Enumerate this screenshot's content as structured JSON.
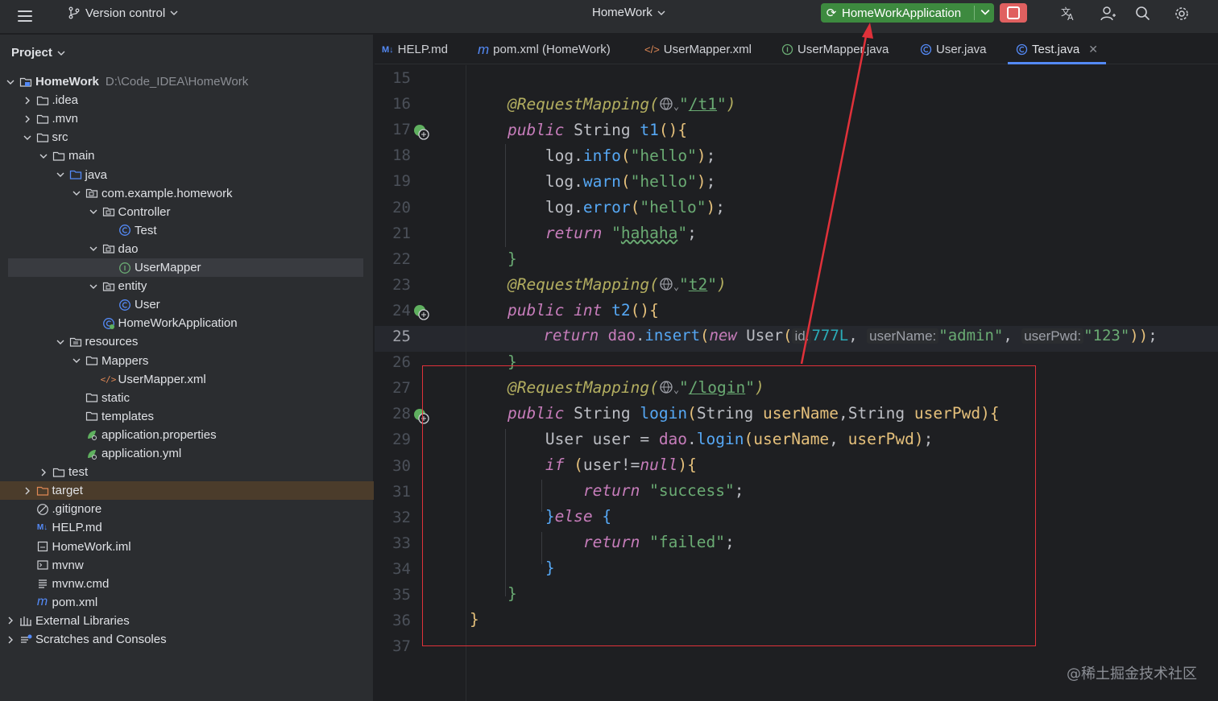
{
  "topbar": {
    "vcs_label": "Version control",
    "project_title": "HomeWork",
    "run_config": "HomeWorkApplication",
    "accent_green": "#3d8a3f",
    "stop_color": "#e06060"
  },
  "project_panel": {
    "header": "Project",
    "root_name": "HomeWork",
    "root_path": "D:\\Code_IDEA\\HomeWork",
    "items": [
      {
        "label": ".idea"
      },
      {
        "label": ".mvn"
      },
      {
        "label": "src"
      },
      {
        "label": "main"
      },
      {
        "label": "java"
      },
      {
        "label": "com.example.homework"
      },
      {
        "label": "Controller"
      },
      {
        "label": "Test"
      },
      {
        "label": "dao"
      },
      {
        "label": "UserMapper"
      },
      {
        "label": "entity"
      },
      {
        "label": "User"
      },
      {
        "label": "HomeWorkApplication"
      },
      {
        "label": "resources"
      },
      {
        "label": "Mappers"
      },
      {
        "label": "UserMapper.xml"
      },
      {
        "label": "static"
      },
      {
        "label": "templates"
      },
      {
        "label": "application.properties"
      },
      {
        "label": "application.yml"
      },
      {
        "label": "test"
      },
      {
        "label": "target"
      },
      {
        "label": ".gitignore"
      },
      {
        "label": "HELP.md"
      },
      {
        "label": "HomeWork.iml"
      },
      {
        "label": "mvnw"
      },
      {
        "label": "mvnw.cmd"
      },
      {
        "label": "pom.xml"
      },
      {
        "label": "External Libraries"
      },
      {
        "label": "Scratches and Consoles"
      }
    ]
  },
  "tabs": [
    {
      "label": "HELP.md",
      "icon": "M↓"
    },
    {
      "label": "pom.xml (HomeWork)",
      "icon": "m"
    },
    {
      "label": "UserMapper.xml",
      "icon": "</>"
    },
    {
      "label": "UserMapper.java",
      "icon": "I"
    },
    {
      "label": "User.java",
      "icon": "C"
    },
    {
      "label": "Test.java",
      "icon": "C"
    }
  ],
  "editor": {
    "line_numbers": [
      "15",
      "16",
      "17",
      "18",
      "19",
      "20",
      "21",
      "22",
      "23",
      "24",
      "25",
      "26",
      "27",
      "28",
      "29",
      "30",
      "31",
      "32",
      "33",
      "34",
      "35",
      "36",
      "37"
    ],
    "current_line": "25",
    "hints": {
      "id": "id:",
      "userName": "userName:",
      "userPwd": "userPwd:"
    }
  },
  "watermark": "@稀土掘金技术社区"
}
